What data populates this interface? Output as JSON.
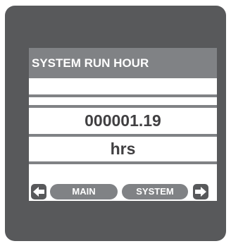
{
  "screen": {
    "title": "SYSTEM RUN HOUR",
    "value": "000001.19",
    "unit": "hrs"
  },
  "nav": {
    "left_icon": "arrow-left-icon",
    "right_icon": "arrow-right-icon",
    "buttons": [
      {
        "label": "MAIN"
      },
      {
        "label": "SYSTEM"
      }
    ]
  },
  "colors": {
    "bezel": "#58595b",
    "title_bar": "#808285",
    "text": "#414042",
    "screen_bg": "#ffffff"
  }
}
